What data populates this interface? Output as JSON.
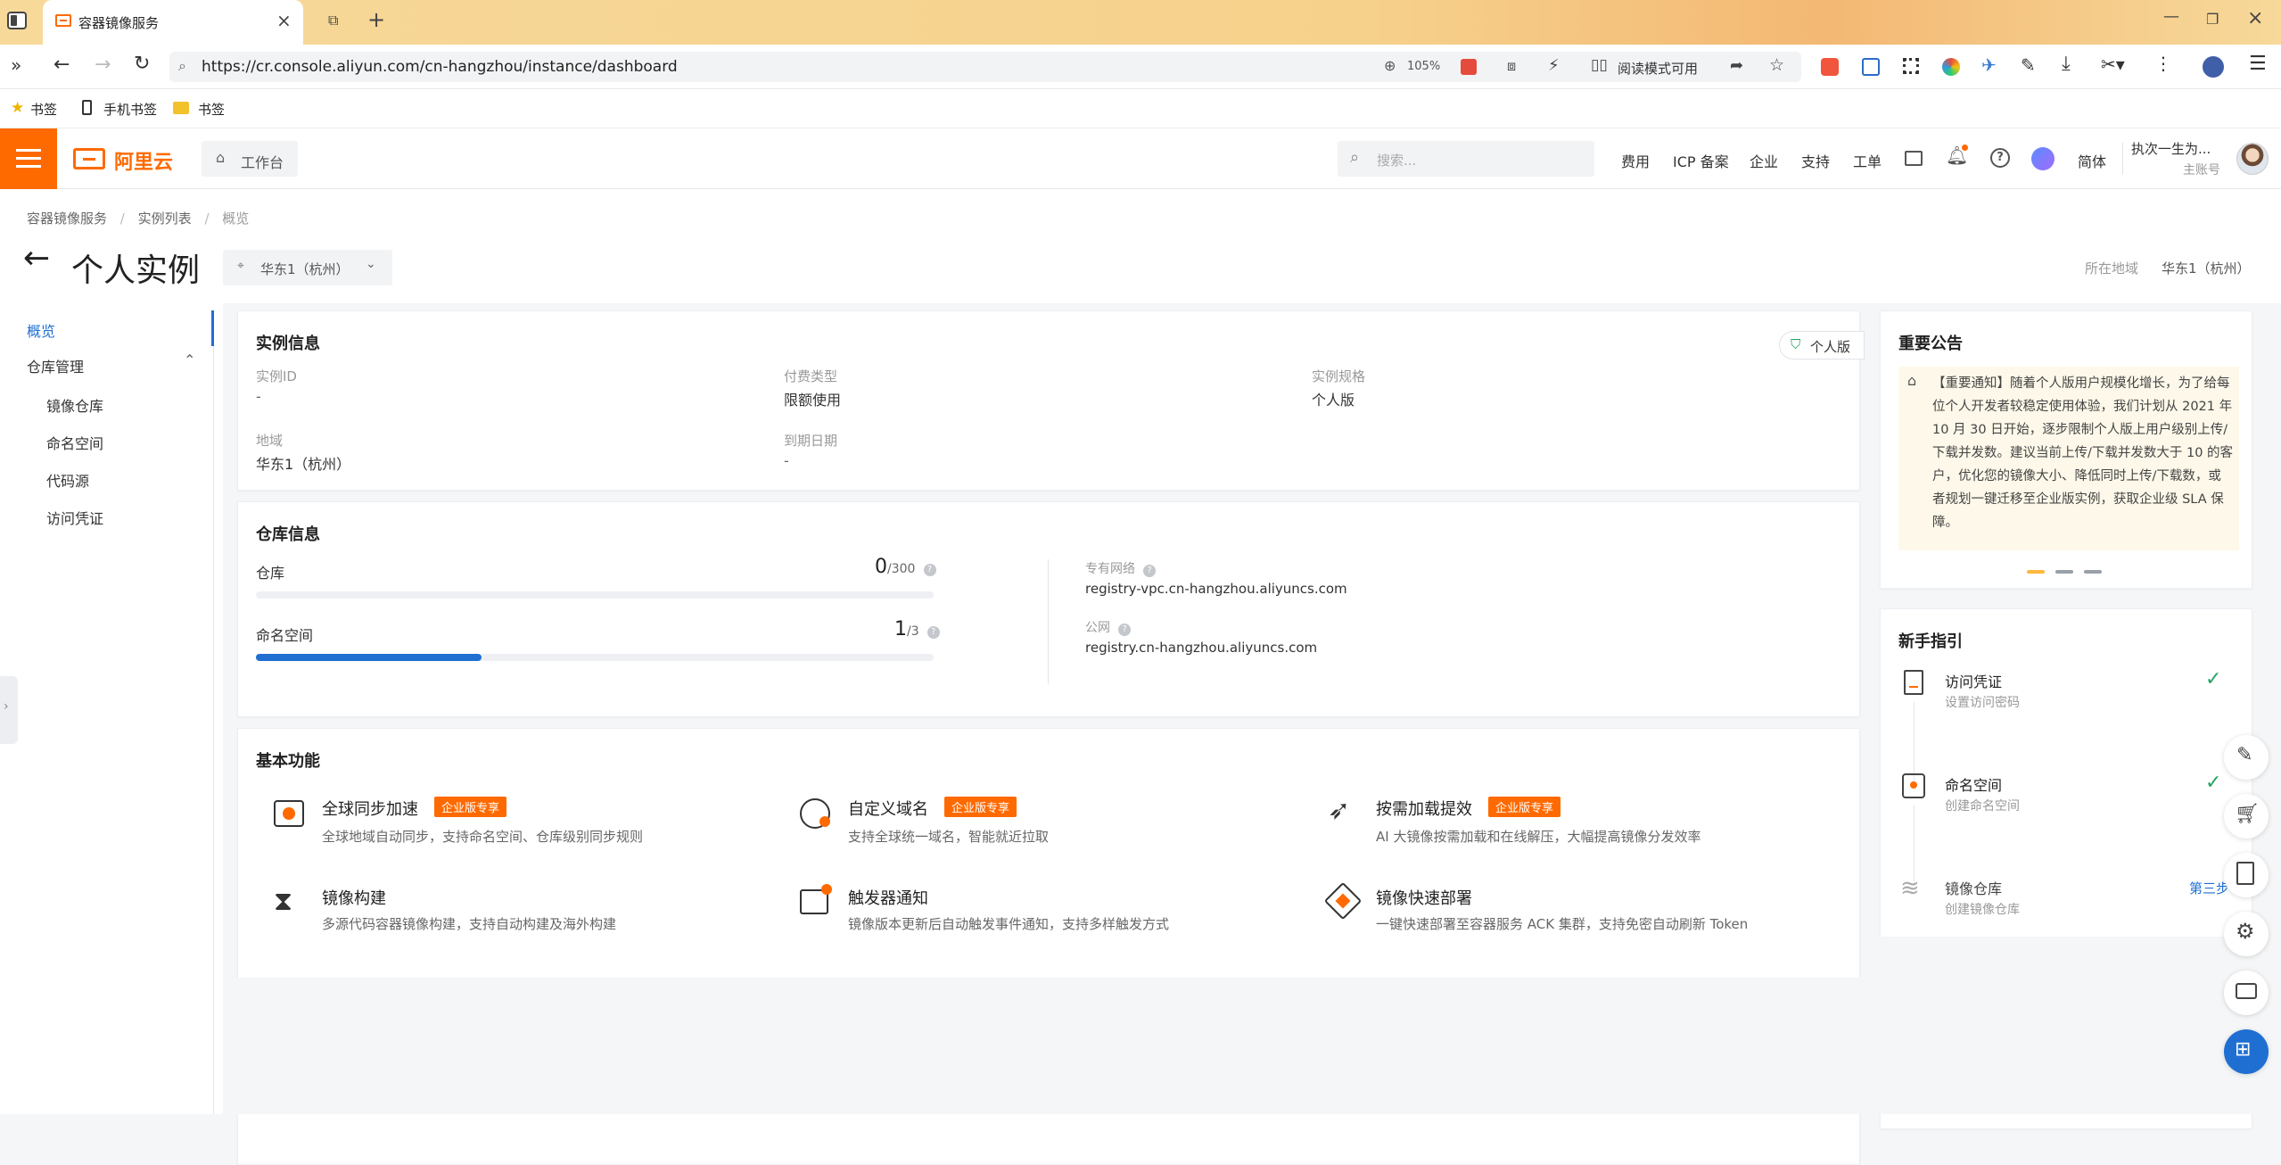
{
  "browser": {
    "tab_title": "容器镜像服务",
    "url": "https://cr.console.aliyun.com/cn-hangzhou/instance/dashboard",
    "zoom": "105%",
    "reader_mode": "阅读模式可用",
    "bookmarks": [
      "书签",
      "手机书签",
      "书签"
    ]
  },
  "console": {
    "brand": "阿里云",
    "workbench": "工作台",
    "search_placeholder": "搜索...",
    "nav": [
      "费用",
      "ICP 备案",
      "企业",
      "支持",
      "工单"
    ],
    "lang": "简体",
    "user_name": "执次一生为...",
    "user_role": "主账号"
  },
  "breadcrumb": [
    "容器镜像服务",
    "实例列表",
    "概览"
  ],
  "page": {
    "title": "个人实例",
    "region_select": "华东1（杭州）",
    "region_label": "所在地域",
    "region_value": "华东1（杭州）"
  },
  "sidebar": {
    "overview": "概览",
    "repo_mgmt": "仓库管理",
    "items": [
      "镜像仓库",
      "命名空间",
      "代码源",
      "访问凭证"
    ]
  },
  "instance_info": {
    "title": "实例信息",
    "badge": "个人版",
    "fields": [
      {
        "label": "实例ID",
        "value": "-"
      },
      {
        "label": "付费类型",
        "value": "限额使用"
      },
      {
        "label": "实例规格",
        "value": "个人版"
      },
      {
        "label": "地域",
        "value": "华东1（杭州）"
      },
      {
        "label": "到期日期",
        "value": "-"
      }
    ]
  },
  "repo_info": {
    "title": "仓库信息",
    "repo_label": "仓库",
    "repo_used": "0",
    "repo_total": "/300",
    "repo_fraction": 0.0,
    "ns_label": "命名空间",
    "ns_used": "1",
    "ns_total": "/3",
    "ns_fraction": 0.333,
    "vpc_label": "专有网络",
    "vpc_value": "registry-vpc.cn-hangzhou.aliyuncs.com",
    "public_label": "公网",
    "public_value": "registry.cn-hangzhou.aliyuncs.com"
  },
  "features": {
    "title": "基本功能",
    "enterprise_tag": "企业版专享",
    "items": [
      {
        "name": "全球同步加速",
        "desc": "全球地域自动同步，支持命名空间、仓库级别同步规则"
      },
      {
        "name": "自定义域名",
        "desc": "支持全球统一域名，智能就近拉取"
      },
      {
        "name": "按需加载提效",
        "desc": "AI 大镜像按需加载和在线解压，大幅提高镜像分发效率"
      },
      {
        "name": "镜像构建",
        "desc": "多源代码容器镜像构建，支持自动构建及海外构建"
      },
      {
        "name": "触发器通知",
        "desc": "镜像版本更新后自动触发事件通知，支持多样触发方式"
      },
      {
        "name": "镜像快速部署",
        "desc": "一键快速部署至容器服务 ACK 集群，支持免密自动刷新 Token"
      }
    ]
  },
  "notice": {
    "title": "重要公告",
    "text": "【重要通知】随着个人版用户规模化增长，为了给每位个人开发者较稳定使用体验，我们计划从 2021 年 10 月 30 日开始，逐步限制个人版上用户级别上传/下载并发数。建议当前上传/下载并发数大于 10 的客户，优化您的镜像大小、降低同时上传/下载数，或者规划一键迁移至企业版实例，获取企业级 SLA 保障。"
  },
  "guide": {
    "title": "新手指引",
    "steps": [
      {
        "name": "访问凭证",
        "desc": "设置访问密码",
        "done": true
      },
      {
        "name": "命名空间",
        "desc": "创建命名空间",
        "done": true
      },
      {
        "name": "镜像仓库",
        "desc": "创建镜像仓库",
        "done": false,
        "step_label": "第三步"
      }
    ]
  },
  "colors": {
    "brand": "#ff6a00",
    "primary": "#1f6fd2",
    "success": "#23a566"
  }
}
